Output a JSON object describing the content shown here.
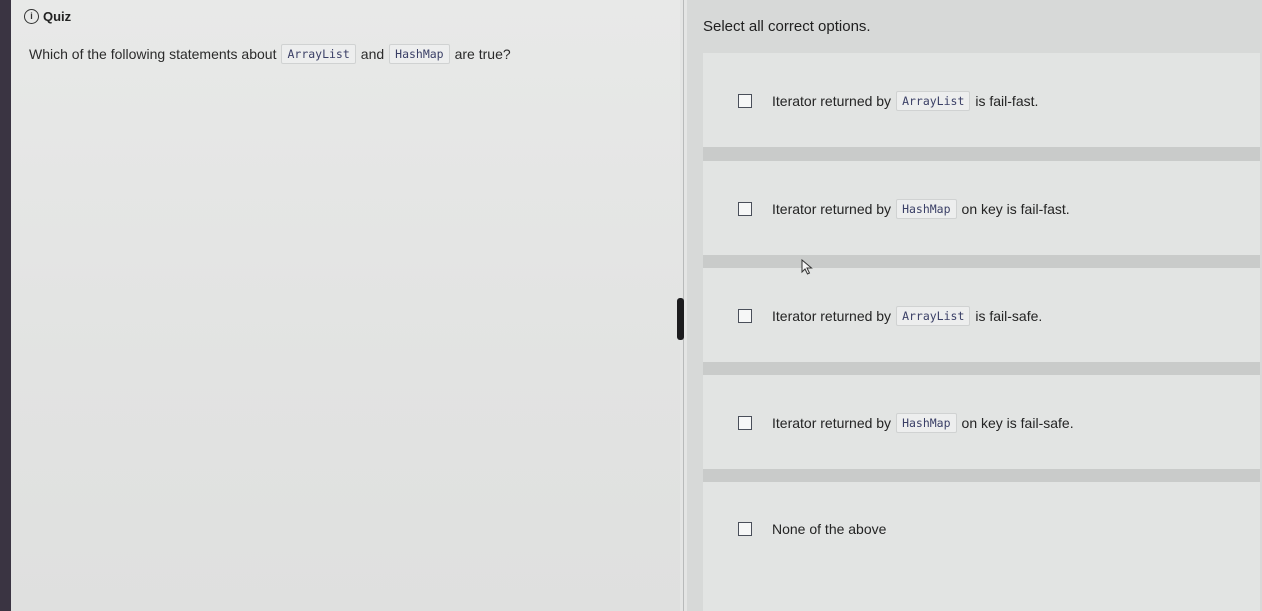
{
  "header": {
    "icon": "quiz-icon",
    "title": "Quiz"
  },
  "question": {
    "prefix": "Which of the following statements about",
    "code1": "ArrayList",
    "middle": "and",
    "code2": "HashMap",
    "suffix": "are true?"
  },
  "instruction": "Select all correct options.",
  "options": [
    {
      "text1": "Iterator returned by",
      "code": "ArrayList",
      "text2": "is fail-fast.",
      "checked": false
    },
    {
      "text1": "Iterator returned by",
      "code": "HashMap",
      "text2": "on key is fail-fast.",
      "checked": false
    },
    {
      "text1": "Iterator returned by",
      "code": "ArrayList",
      "text2": "is fail-safe.",
      "checked": false
    },
    {
      "text1": "Iterator returned by",
      "code": "HashMap",
      "text2": "on key is fail-safe.",
      "checked": false
    },
    {
      "text1": "None of the above",
      "code": "",
      "text2": "",
      "checked": false
    }
  ]
}
